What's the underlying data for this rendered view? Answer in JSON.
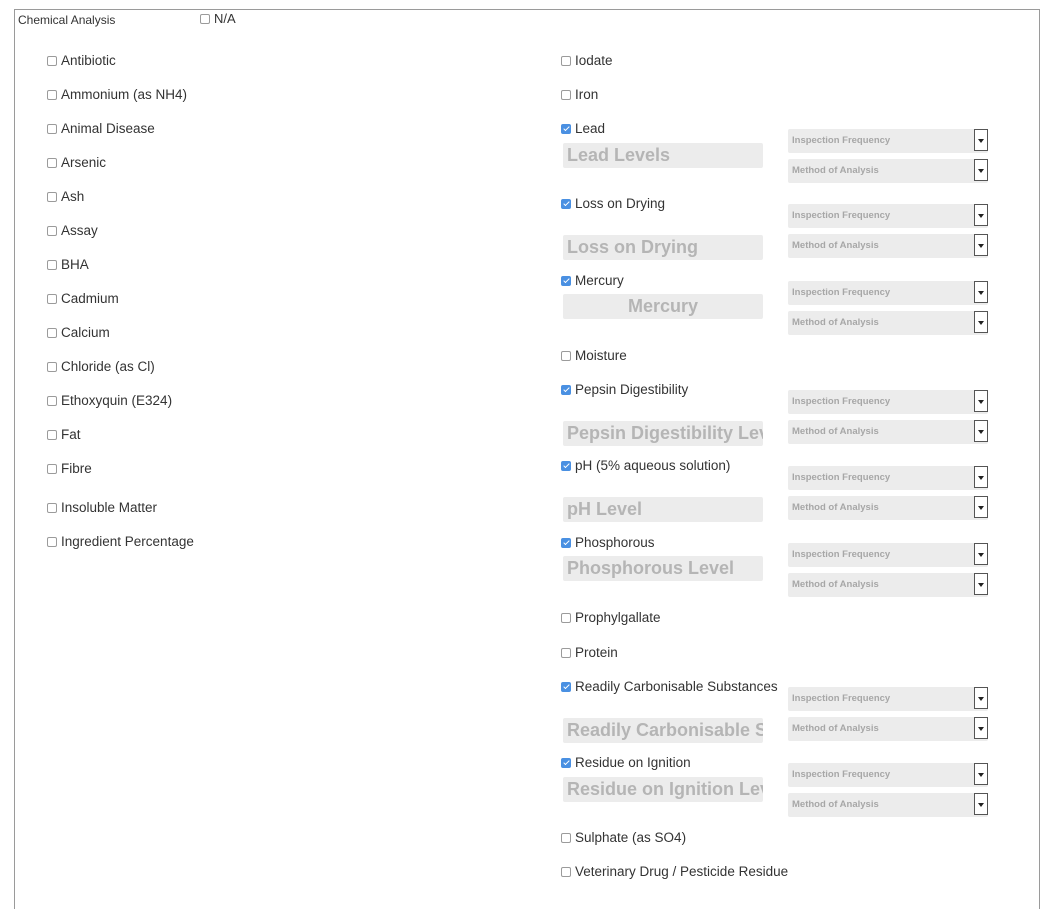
{
  "section": {
    "title": "Chemical Analysis",
    "na_label": "N/A",
    "na_checked": false
  },
  "left_items": [
    {
      "label": "Antibiotic",
      "checked": false
    },
    {
      "label": "Ammonium (as NH4)",
      "checked": false
    },
    {
      "label": "Animal Disease",
      "checked": false
    },
    {
      "label": "Arsenic",
      "checked": false
    },
    {
      "label": "Ash",
      "checked": false
    },
    {
      "label": "Assay",
      "checked": false
    },
    {
      "label": "BHA",
      "checked": false
    },
    {
      "label": "Cadmium",
      "checked": false
    },
    {
      "label": "Calcium",
      "checked": false
    },
    {
      "label": "Chloride (as Cl)",
      "checked": false
    },
    {
      "label": "Ethoxyquin (E324)",
      "checked": false
    },
    {
      "label": "Fat",
      "checked": false
    },
    {
      "label": "Fibre",
      "checked": false
    },
    {
      "label": "Insoluble Matter",
      "checked": false
    },
    {
      "label": "Ingredient Percentage",
      "checked": false
    }
  ],
  "right_items": [
    {
      "label": "Iodate",
      "checked": false
    },
    {
      "label": "Iron",
      "checked": false
    },
    {
      "label": "Lead",
      "checked": true,
      "level_placeholder": "Lead Levels"
    },
    {
      "label": "Loss on Drying",
      "checked": true,
      "level_placeholder": "Loss on Drying"
    },
    {
      "label": "Mercury",
      "checked": true,
      "level_placeholder": "Mercury"
    },
    {
      "label": "Moisture",
      "checked": false
    },
    {
      "label": "Pepsin Digestibility",
      "checked": true,
      "level_placeholder": "Pepsin Digestibility Level"
    },
    {
      "label": "pH (5% aqueous solution)",
      "checked": true,
      "level_placeholder": "pH Level"
    },
    {
      "label": "Phosphorous",
      "checked": true,
      "level_placeholder": "Phosphorous Level"
    },
    {
      "label": "Prophylgallate",
      "checked": false
    },
    {
      "label": "Protein",
      "checked": false
    },
    {
      "label": "Readily Carbonisable Substances",
      "checked": true,
      "level_placeholder": "Readily Carbonisable Substances"
    },
    {
      "label": "Residue on Ignition",
      "checked": true,
      "level_placeholder": "Residue on Ignition Level"
    },
    {
      "label": "Sulphate (as SO4)",
      "checked": false
    },
    {
      "label": "Veterinary Drug / Pesticide Residue",
      "checked": false
    }
  ],
  "selects": {
    "inspection_frequency": "Inspection Frequency",
    "method_of_analysis": "Method of Analysis"
  }
}
